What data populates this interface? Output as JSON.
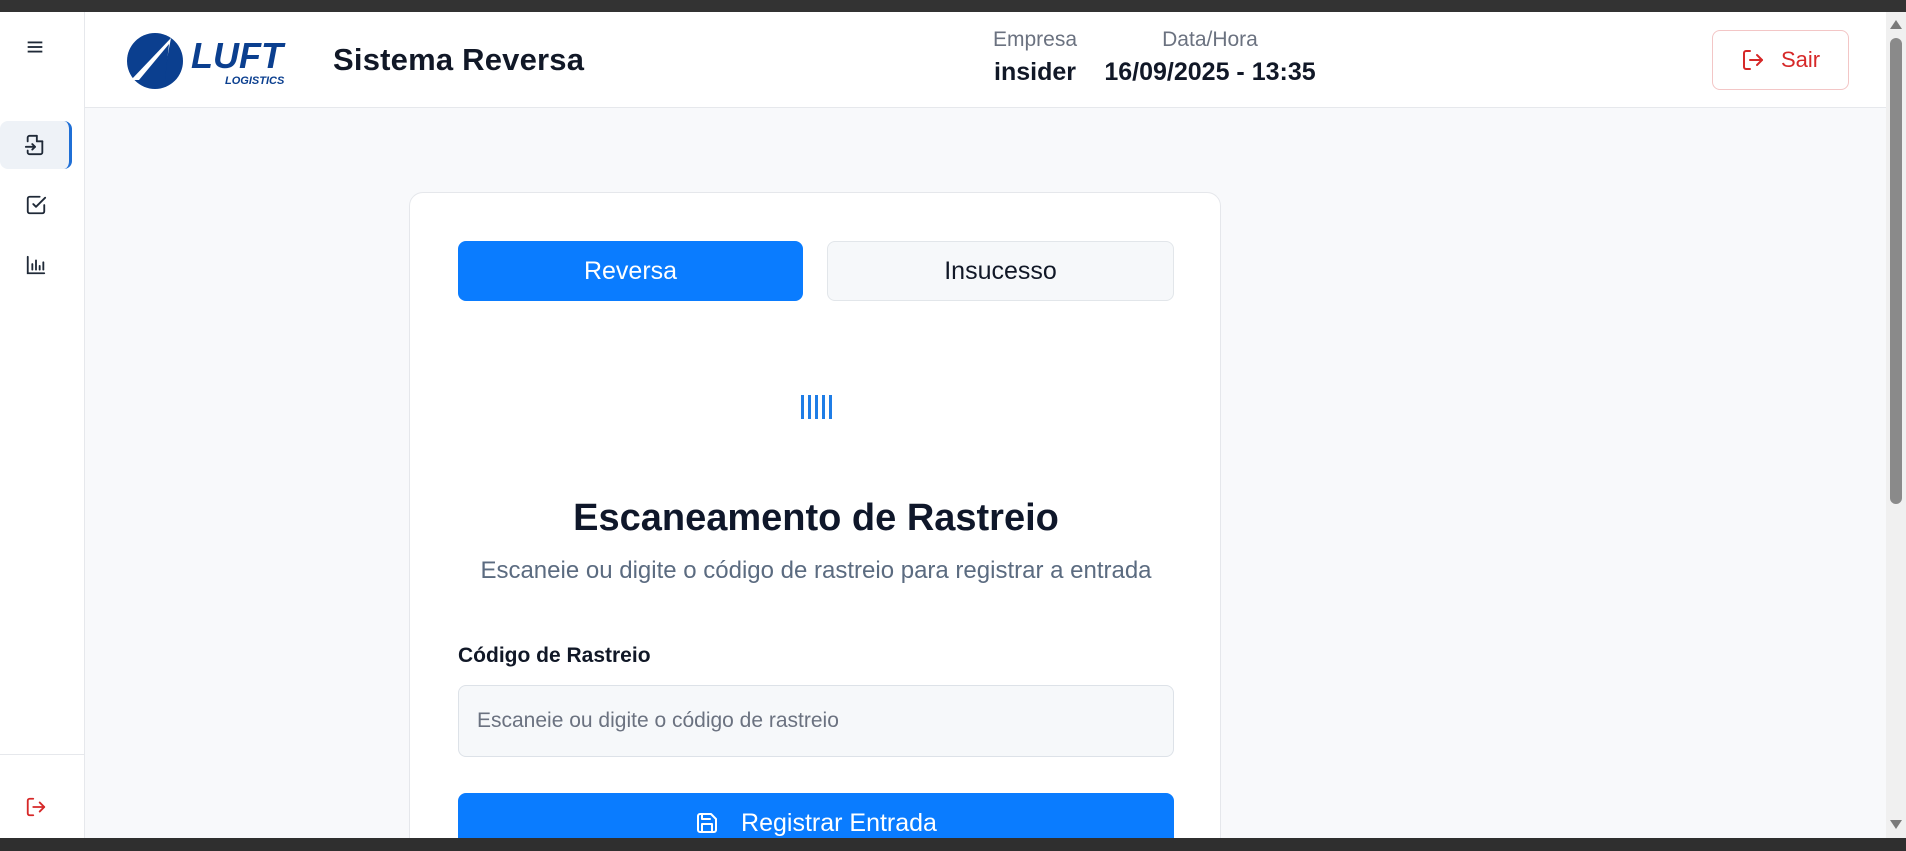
{
  "app": {
    "title": "Sistema Reversa"
  },
  "logo": {
    "text": "LUFT",
    "subtext": "LOGISTICS"
  },
  "header": {
    "company_label": "Empresa",
    "company_value": "insider",
    "datetime_label": "Data/Hora",
    "datetime_value": "16/09/2025 - 13:35",
    "logout_label": "Sair"
  },
  "sidebar": {
    "items": [
      {
        "icon": "file-input-icon",
        "active": true
      },
      {
        "icon": "checkbox-icon",
        "active": false
      },
      {
        "icon": "bar-chart-icon",
        "active": false
      }
    ],
    "footer_icon": "logout-icon"
  },
  "tabs": [
    {
      "label": "Reversa",
      "active": true
    },
    {
      "label": "Insucesso",
      "active": false
    }
  ],
  "scan": {
    "icon": "barcode-icon",
    "title": "Escaneamento de Rastreio",
    "subtitle": "Escaneie ou digite o código de rastreio para registrar a entrada",
    "field_label": "Código de Rastreio",
    "placeholder": "Escaneie ou digite o código de rastreio",
    "value": "",
    "submit_label": "Registrar Entrada"
  },
  "colors": {
    "primary": "#0a7cff",
    "danger": "#d62828",
    "brand": "#0b3f8f"
  }
}
